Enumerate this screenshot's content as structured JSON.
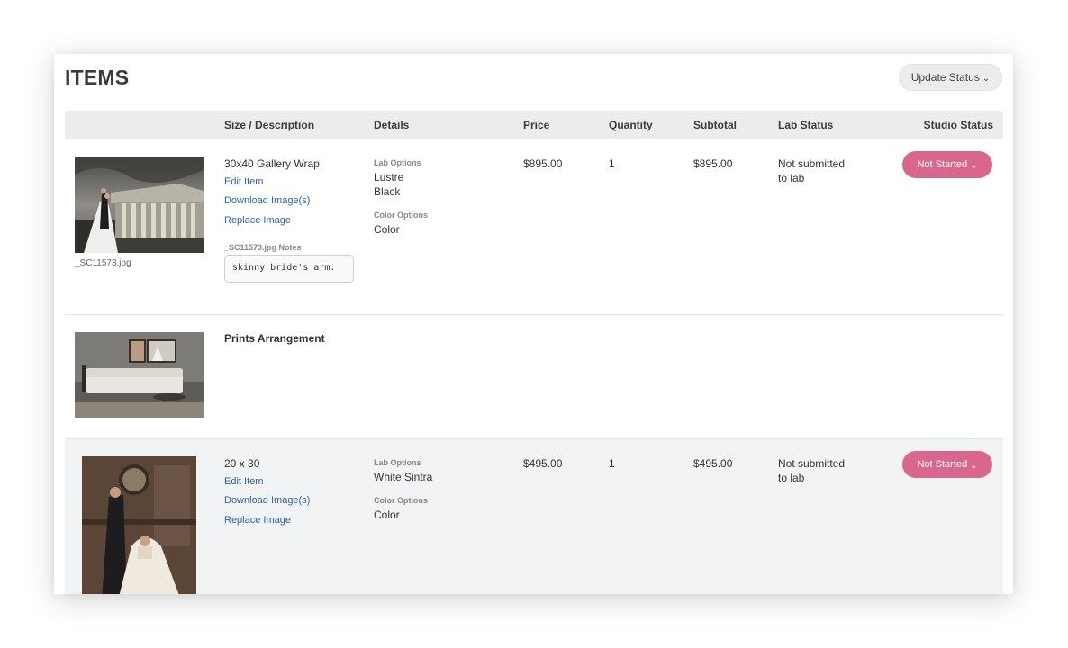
{
  "header": {
    "title": "ITEMS",
    "update_status_label": "Update Status"
  },
  "columns": {
    "size_description": "Size / Description",
    "details": "Details",
    "price": "Price",
    "quantity": "Quantity",
    "subtotal": "Subtotal",
    "lab_status": "Lab Status",
    "studio_status": "Studio Status"
  },
  "items": [
    {
      "filename": "_SC11573.jpg",
      "description": "30x40 Gallery Wrap",
      "edit_label": "Edit Item",
      "download_label": "Download Image(s)",
      "replace_label": "Replace Image",
      "lab_options_label": "Lab Options",
      "lab_options": [
        "Lustre",
        "Black"
      ],
      "color_options_label": "Color Options",
      "color_option": "Color",
      "notes_label": "_SC11573.jpg Notes",
      "notes_value": "skinny bride's arm.",
      "price": "$895.00",
      "quantity": "1",
      "subtotal": "$895.00",
      "lab_status": "Not submitted to lab",
      "studio_status": "Not Started"
    },
    {
      "description": "Prints Arrangement"
    },
    {
      "description": "20 x 30",
      "edit_label": "Edit Item",
      "download_label": "Download Image(s)",
      "replace_label": "Replace Image",
      "lab_options_label": "Lab Options",
      "lab_options": [
        "White Sintra"
      ],
      "color_options_label": "Color Options",
      "color_option": "Color",
      "price": "$495.00",
      "quantity": "1",
      "subtotal": "$495.00",
      "lab_status": "Not submitted to lab",
      "studio_status": "Not Started"
    }
  ],
  "icons": {
    "dropdown": "chevron-down-icon"
  },
  "colors": {
    "accent_pink": "#d9668d",
    "link_blue": "#2f5fa8",
    "header_gray": "#ececec"
  }
}
